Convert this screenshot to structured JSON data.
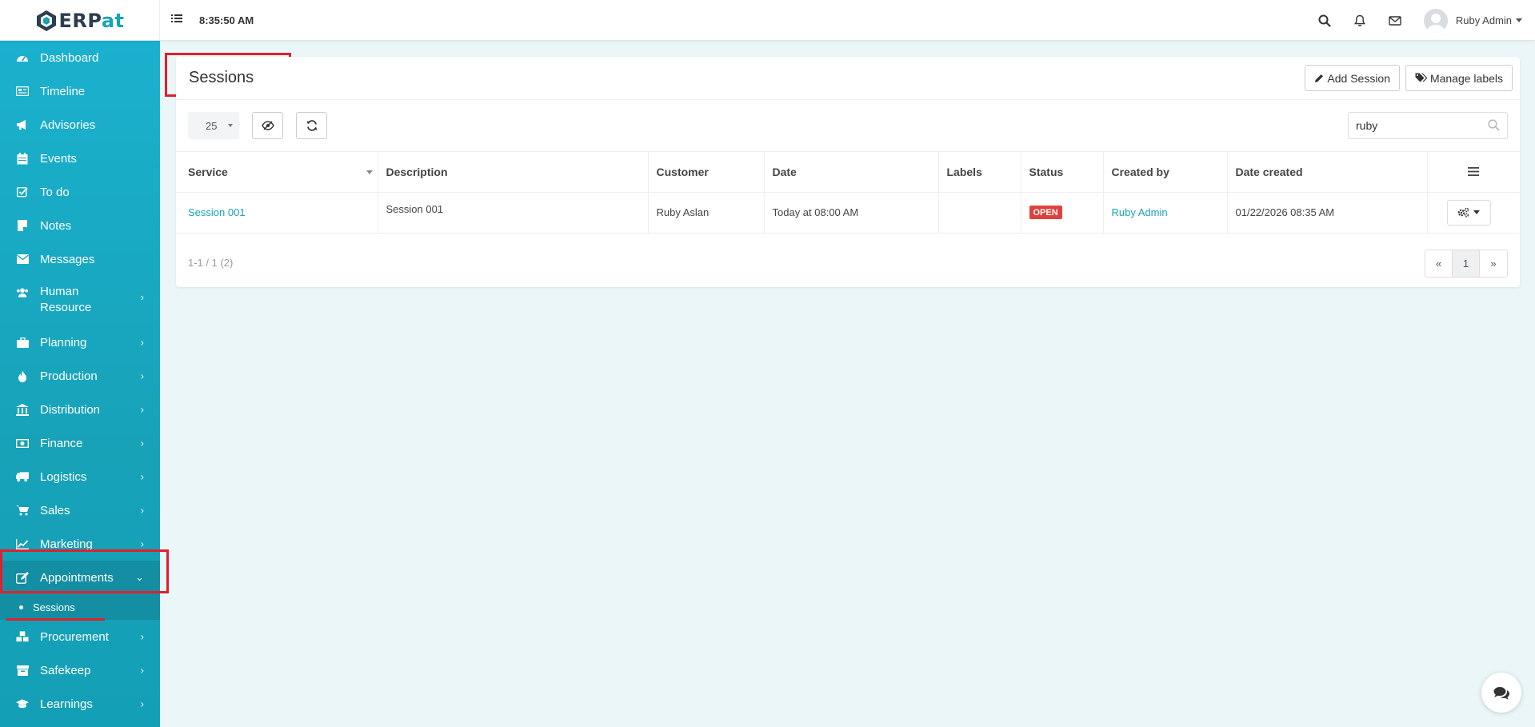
{
  "app": {
    "logo_text_a": "ERP",
    "logo_text_b": "at",
    "clock": "8:35:50 AM",
    "user_name": "Ruby Admin"
  },
  "sidebar": {
    "items": [
      {
        "label": "Dashboard",
        "icon": "dashboard-icon"
      },
      {
        "label": "Timeline",
        "icon": "timeline-icon"
      },
      {
        "label": "Advisories",
        "icon": "bullhorn-icon"
      },
      {
        "label": "Events",
        "icon": "calendar-icon"
      },
      {
        "label": "To do",
        "icon": "checkbox-icon"
      },
      {
        "label": "Notes",
        "icon": "note-icon"
      },
      {
        "label": "Messages",
        "icon": "envelope-icon"
      },
      {
        "label": "Human Resource",
        "icon": "users-icon"
      },
      {
        "label": "Planning",
        "icon": "briefcase-icon"
      },
      {
        "label": "Production",
        "icon": "fire-icon"
      },
      {
        "label": "Distribution",
        "icon": "bank-icon"
      },
      {
        "label": "Finance",
        "icon": "money-icon"
      },
      {
        "label": "Logistics",
        "icon": "truck-icon"
      },
      {
        "label": "Sales",
        "icon": "cart-icon"
      },
      {
        "label": "Marketing",
        "icon": "chart-icon"
      },
      {
        "label": "Appointments",
        "icon": "edit-icon"
      },
      {
        "label": "Procurement",
        "icon": "cubes-icon"
      },
      {
        "label": "Safekeep",
        "icon": "archive-icon"
      },
      {
        "label": "Learnings",
        "icon": "graduation-icon"
      }
    ],
    "sub_items": [
      {
        "label": "Sessions"
      }
    ]
  },
  "main": {
    "title": "Sessions",
    "add_button": "Add Session",
    "labels_button": "Manage labels",
    "page_size": "25",
    "search_value": "ruby",
    "columns": [
      "Service",
      "Description",
      "Customer",
      "Date",
      "Labels",
      "Status",
      "Created by",
      "Date created"
    ],
    "rows": [
      {
        "service": "Session 001",
        "description": "Session 001",
        "customer": "Ruby Aslan",
        "date": "Today at 08:00 AM",
        "labels": "",
        "status": "OPEN",
        "created_by": "Ruby Admin",
        "date_created": "01/22/2026 08:35 AM"
      }
    ],
    "pager_info": "1-1 / 1 (2)",
    "pager": {
      "prev": "«",
      "current": "1",
      "next": "»"
    }
  },
  "colors": {
    "accent": "#17a2b8",
    "sidebar_active": "#138ea3",
    "status_open": "#e0413d",
    "highlight": "#e0202c"
  }
}
